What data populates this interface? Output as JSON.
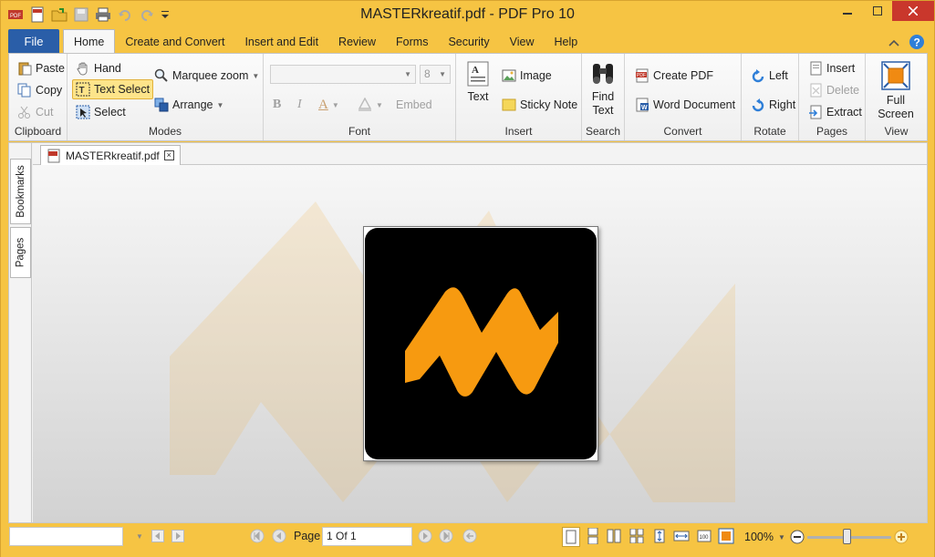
{
  "window": {
    "title": "MASTERkreatif.pdf - PDF Pro 10",
    "accent": "#f6c443",
    "file_color": "#2a5ea8"
  },
  "tabs": {
    "file": "File",
    "items": [
      "Home",
      "Create and Convert",
      "Insert and Edit",
      "Review",
      "Forms",
      "Security",
      "View",
      "Help"
    ]
  },
  "ribbon": {
    "clipboard": {
      "label": "Clipboard",
      "paste": "Paste",
      "copy": "Copy",
      "cut": "Cut"
    },
    "modes": {
      "label": "Modes",
      "hand": "Hand",
      "text_select": "Text Select",
      "select": "Select",
      "marquee_zoom": "Marquee zoom",
      "arrange": "Arrange"
    },
    "font": {
      "label": "Font",
      "font_name": "",
      "font_size": "8",
      "bold": "B",
      "italic": "I",
      "color_a": "A",
      "embed": "Embed"
    },
    "insert": {
      "label": "Insert",
      "text": "Text",
      "image": "Image",
      "sticky_note": "Sticky Note"
    },
    "search": {
      "label": "Search",
      "find_text_1": "Find",
      "find_text_2": "Text"
    },
    "convert": {
      "label": "Convert",
      "create_pdf": "Create PDF",
      "word_document": "Word Document"
    },
    "rotate": {
      "label": "Rotate",
      "left": "Left",
      "right": "Right"
    },
    "pages": {
      "label": "Pages",
      "insert": "Insert",
      "delete": "Delete",
      "extract": "Extract"
    },
    "view": {
      "label": "View",
      "full_screen_1": "Full",
      "full_screen_2": "Screen"
    }
  },
  "sidebar": {
    "bookmarks": "Bookmarks",
    "pages": "Pages"
  },
  "document": {
    "tab_name": "MASTERkreatif.pdf",
    "close": "×",
    "logo_color": "#f79a10"
  },
  "statusbar": {
    "page_label": "Page",
    "page_value": "1 Of 1",
    "zoom": "100%",
    "search_value": ""
  }
}
